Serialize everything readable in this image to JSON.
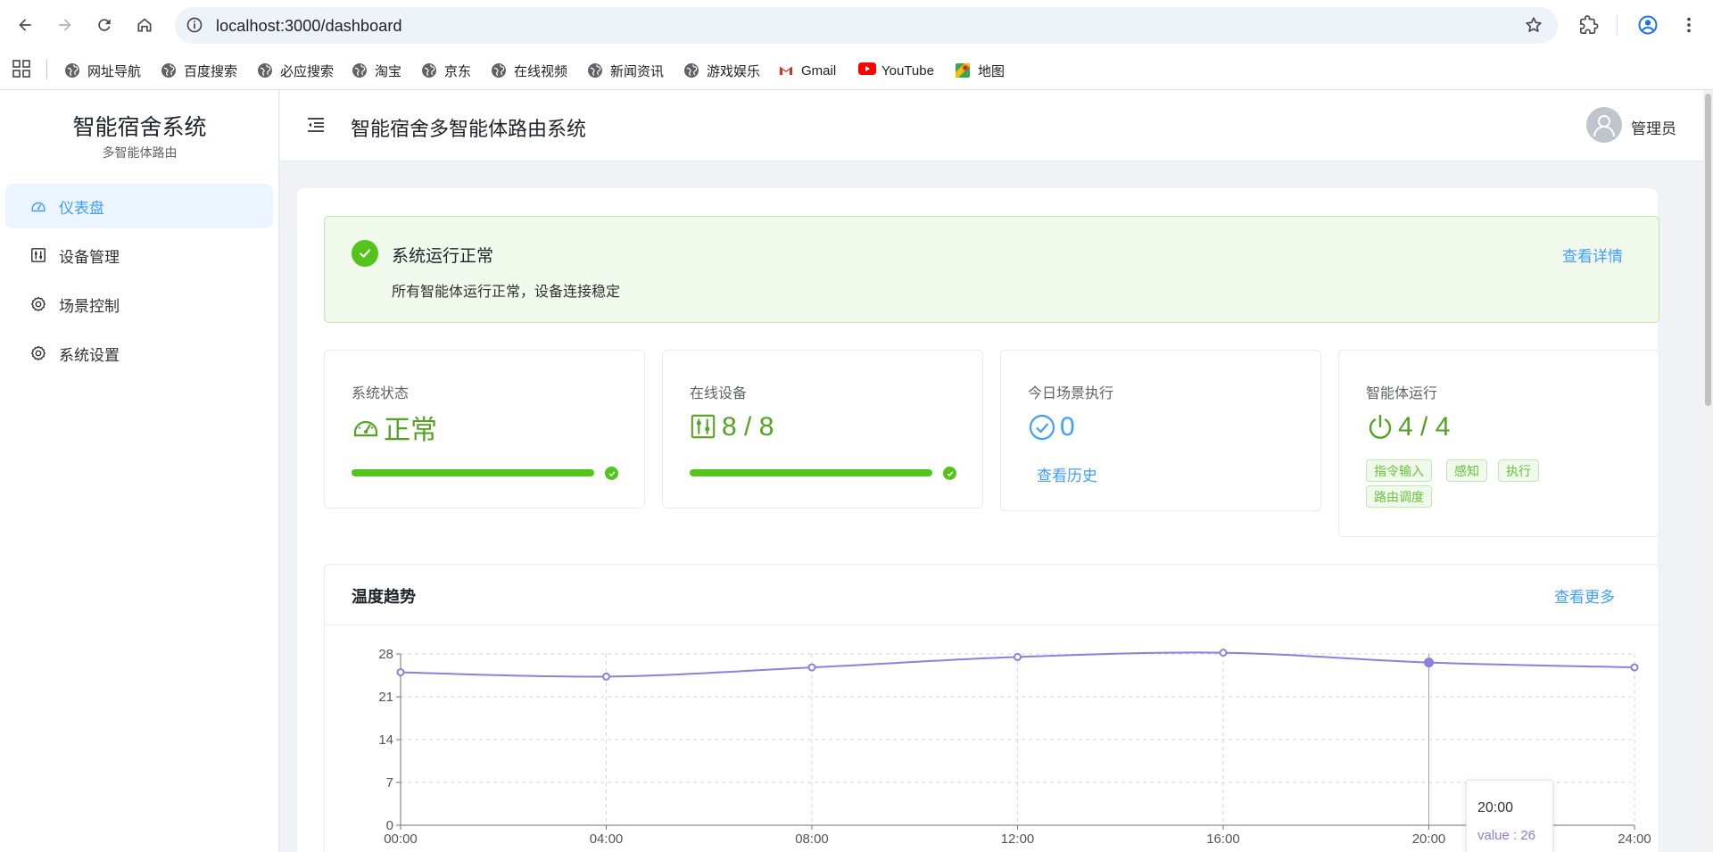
{
  "browser": {
    "url": "localhost:3000/dashboard",
    "bookmarks": [
      {
        "label": "网址导航",
        "icon": "globe-icon"
      },
      {
        "label": "百度搜索",
        "icon": "globe-icon"
      },
      {
        "label": "必应搜索",
        "icon": "globe-icon"
      },
      {
        "label": "淘宝",
        "icon": "globe-icon"
      },
      {
        "label": "京东",
        "icon": "globe-icon"
      },
      {
        "label": "在线视频",
        "icon": "globe-icon"
      },
      {
        "label": "新闻资讯",
        "icon": "globe-icon"
      },
      {
        "label": "游戏娱乐",
        "icon": "globe-icon"
      },
      {
        "label": "Gmail",
        "icon": "gmail-icon"
      },
      {
        "label": "YouTube",
        "icon": "youtube-icon"
      },
      {
        "label": "地图",
        "icon": "maps-icon"
      }
    ]
  },
  "sidebar": {
    "title": "智能宿舍系统",
    "subtitle": "多智能体路由",
    "items": [
      {
        "label": "仪表盘",
        "icon": "dashboard-icon",
        "active": true
      },
      {
        "label": "设备管理",
        "icon": "devices-icon",
        "active": false
      },
      {
        "label": "场景控制",
        "icon": "gear-icon",
        "active": false
      },
      {
        "label": "系统设置",
        "icon": "gear-icon",
        "active": false
      }
    ]
  },
  "header": {
    "title": "智能宿舍多智能体路由系统",
    "user": "管理员"
  },
  "alert": {
    "title": "系统运行正常",
    "description": "所有智能体运行正常，设备连接稳定",
    "link": "查看详情"
  },
  "stats": [
    {
      "label": "系统状态",
      "value": "正常",
      "icon": "speedometer-icon",
      "progress": 1.0
    },
    {
      "label": "在线设备",
      "value": "8 / 8",
      "icon": "devices-icon",
      "progress": 1.0
    },
    {
      "label": "今日场景执行",
      "value": "0",
      "icon": "check-circle-icon",
      "link": "查看历史"
    },
    {
      "label": "智能体运行",
      "value": "4 / 4",
      "icon": "power-icon",
      "tags": [
        "指令输入",
        "感知",
        "执行",
        "路由调度"
      ]
    }
  ],
  "chart": {
    "title": "温度趋势",
    "more": "查看更多",
    "tooltip": {
      "x": "20:00",
      "label": "value",
      "sep": " : ",
      "value": "26"
    }
  },
  "chart_data": {
    "type": "line",
    "title": "温度趋势",
    "x": [
      "00:00",
      "04:00",
      "08:00",
      "12:00",
      "16:00",
      "20:00",
      "24:00"
    ],
    "series": [
      {
        "values": [
          25,
          24.3,
          25.8,
          27.5,
          28.2,
          26.6,
          25.8
        ]
      }
    ],
    "yticks": [
      0,
      7,
      14,
      21,
      28
    ],
    "ylim": [
      0,
      28
    ],
    "grid": true,
    "color": "#8c7fde"
  },
  "colors": {
    "accent": "#409eff",
    "success": "#52c41a",
    "line": "#8c7fde"
  }
}
